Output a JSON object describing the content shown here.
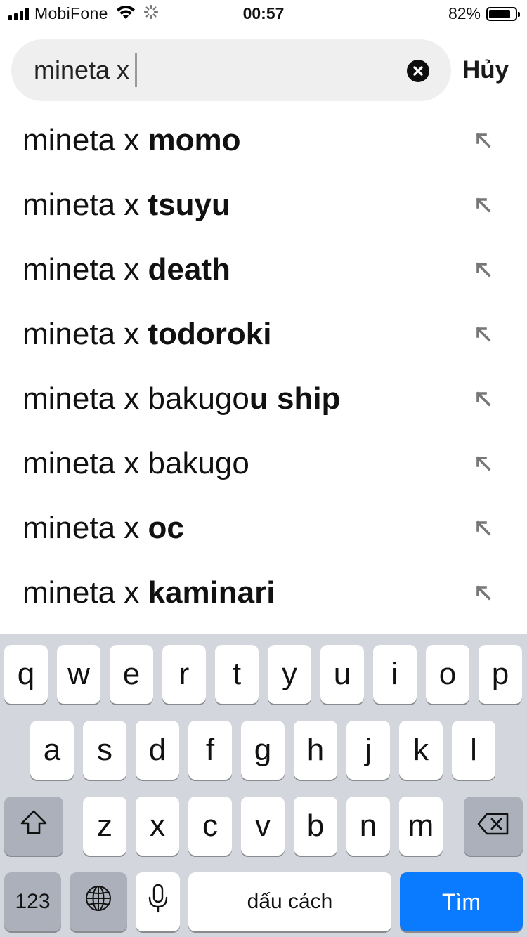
{
  "status_bar": {
    "carrier": "MobiFone",
    "time": "00:57",
    "battery_percent": "82%",
    "battery_level": 0.82,
    "signal_bars": 4
  },
  "search": {
    "query": "mineta x",
    "cancel_label": "Hủy"
  },
  "suggestions": [
    {
      "prefix": "mineta x ",
      "suffix": "momo"
    },
    {
      "prefix": "mineta x ",
      "suffix": "tsuyu"
    },
    {
      "prefix": "mineta x ",
      "suffix": "death"
    },
    {
      "prefix": "mineta x ",
      "suffix": "todoroki"
    },
    {
      "prefix": "mineta x bakugo",
      "suffix": "u ship"
    },
    {
      "prefix": "mineta x bakugo",
      "suffix": ""
    },
    {
      "prefix": "mineta x ",
      "suffix": "oc"
    },
    {
      "prefix": "mineta x ",
      "suffix": "kaminari"
    }
  ],
  "keyboard": {
    "row1": [
      "q",
      "w",
      "e",
      "r",
      "t",
      "y",
      "u",
      "i",
      "o",
      "p"
    ],
    "row2": [
      "a",
      "s",
      "d",
      "f",
      "g",
      "h",
      "j",
      "k",
      "l"
    ],
    "row3": [
      "z",
      "x",
      "c",
      "v",
      "b",
      "n",
      "m"
    ],
    "numbers_label": "123",
    "space_label": "dấu cách",
    "return_label": "Tìm",
    "shift_icon": "shift-icon",
    "delete_icon": "backspace-icon",
    "globe_icon": "globe-icon",
    "mic_icon": "microphone-icon",
    "accent_color": "#0a7aff"
  }
}
